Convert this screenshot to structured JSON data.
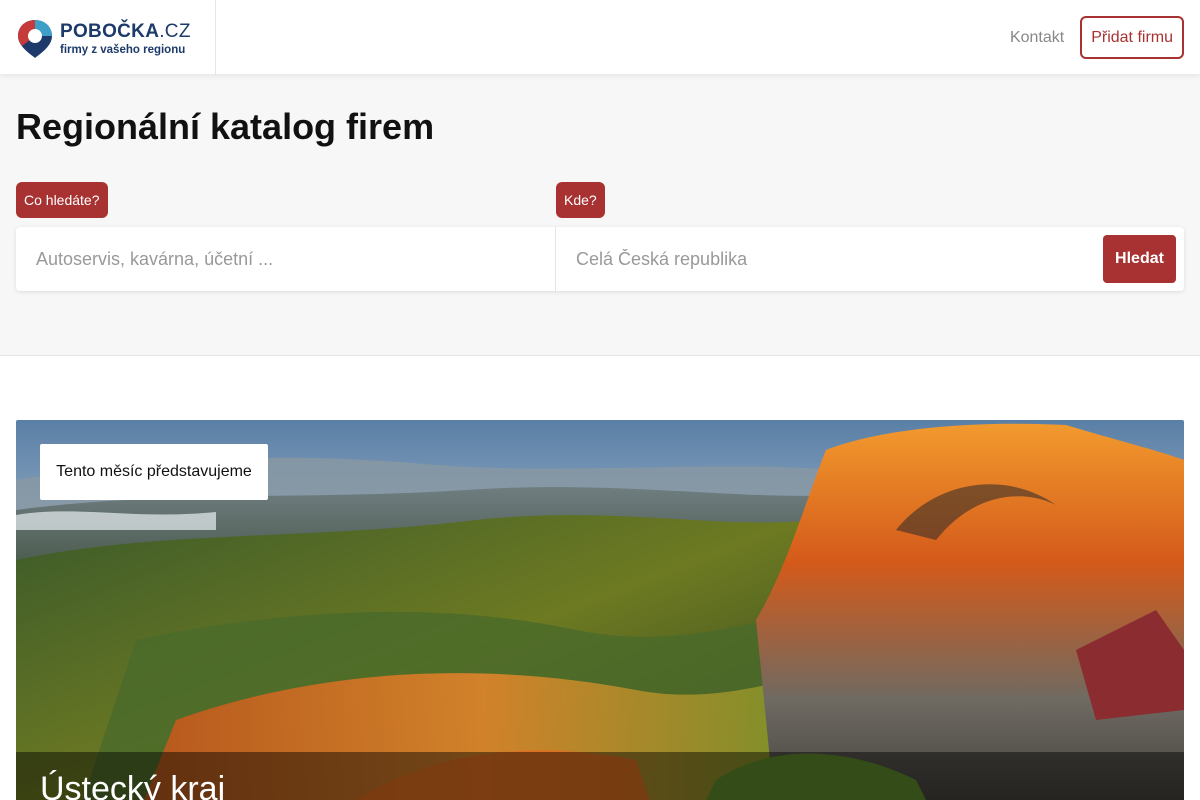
{
  "header": {
    "logo": {
      "name": "POBOČKA",
      "tld": ".CZ",
      "tagline": "firmy z vašeho regionu"
    },
    "nav": {
      "contact_label": "Kontakt",
      "add_company_label": "Přidat firmu"
    }
  },
  "hero": {
    "title": "Regionální katalog firem",
    "what_label": "Co hledáte?",
    "what_placeholder": "Autoservis, kavárna, účetní ...",
    "where_label": "Kde?",
    "where_placeholder": "Celá Česká republika",
    "search_button": "Hledat"
  },
  "featured": {
    "badge": "Tento měsíc představujeme",
    "region": "Ústecký kraj"
  },
  "colors": {
    "accent": "#a83232",
    "brand_navy": "#1d3a6a"
  }
}
